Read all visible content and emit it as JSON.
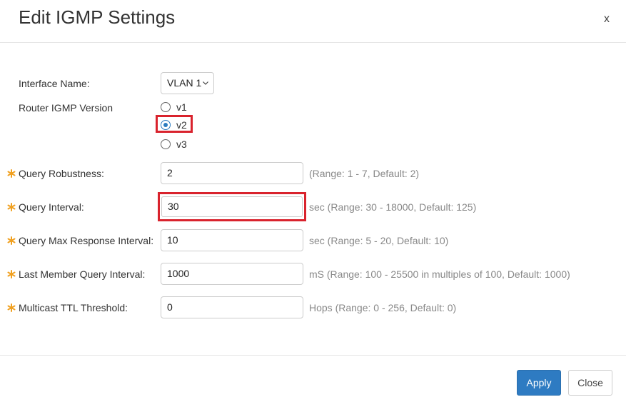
{
  "dialog": {
    "title": "Edit IGMP Settings",
    "close_label": "x"
  },
  "form": {
    "interface_name": {
      "label": "Interface Name:",
      "value": "VLAN 1"
    },
    "router_igmp_version": {
      "label": "Router IGMP Version",
      "options": [
        {
          "label": "v1",
          "checked": false
        },
        {
          "label": "v2",
          "checked": true
        },
        {
          "label": "v3",
          "checked": false
        }
      ]
    },
    "query_robustness": {
      "label": "Query Robustness:",
      "value": "2",
      "hint": "(Range: 1 - 7, Default: 2)",
      "required": true
    },
    "query_interval": {
      "label": "Query Interval:",
      "value": "30",
      "hint": "sec (Range: 30 - 18000, Default: 125)",
      "required": true
    },
    "query_max_response_interval": {
      "label": "Query Max Response Interval:",
      "value": "10",
      "hint": "sec (Range: 5 - 20, Default: 10)",
      "required": true
    },
    "last_member_query_interval": {
      "label": "Last Member Query Interval:",
      "value": "1000",
      "hint": "mS (Range: 100 - 25500 in multiples of 100, Default: 1000)",
      "required": true
    },
    "multicast_ttl_threshold": {
      "label": "Multicast TTL Threshold:",
      "value": "0",
      "hint": "Hops (Range: 0 - 256, Default: 0)",
      "required": true
    }
  },
  "footer": {
    "apply_label": "Apply",
    "close_label": "Close"
  },
  "colors": {
    "accent": "#2e7bc2",
    "highlight": "#d9232d",
    "required_icon": "#f0a020"
  },
  "icons": {
    "required": "required-asterisk-icon",
    "dropdown": "chevron-down-icon"
  }
}
